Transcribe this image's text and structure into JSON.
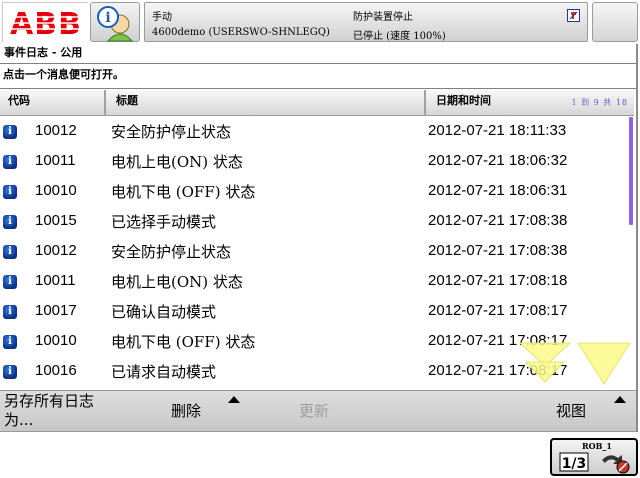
{
  "header": {
    "logo_text": "ABB",
    "mode": "手动",
    "system_name": "4600demo (USERSWO-SHNLEGQ)",
    "guard_status": "防护装置停止",
    "run_state": "已停止 (速度 100%)"
  },
  "window": {
    "title": "事件日志 - 公用",
    "hint": "点击一个消息便可打开。"
  },
  "table": {
    "columns": {
      "code": "代码",
      "title": "标题",
      "datetime": "日期和时间"
    },
    "record_count": "1 到 9 共 18",
    "rows": [
      {
        "code": "10012",
        "title": "安全防护停止状态",
        "datetime": "2012-07-21  18:11:33"
      },
      {
        "code": "10011",
        "title": "电机上电(ON) 状态",
        "datetime": "2012-07-21  18:06:32"
      },
      {
        "code": "10010",
        "title": "电机下电 (OFF) 状态",
        "datetime": "2012-07-21  18:06:31"
      },
      {
        "code": "10015",
        "title": "已选择手动模式",
        "datetime": "2012-07-21  17:08:38"
      },
      {
        "code": "10012",
        "title": "安全防护停止状态",
        "datetime": "2012-07-21  17:08:38"
      },
      {
        "code": "10011",
        "title": "电机上电(ON) 状态",
        "datetime": "2012-07-21  17:08:18"
      },
      {
        "code": "10017",
        "title": "已确认自动模式",
        "datetime": "2012-07-21  17:08:17"
      },
      {
        "code": "10010",
        "title": "电机下电 (OFF) 状态",
        "datetime": "2012-07-21  17:08:17"
      },
      {
        "code": "10016",
        "title": "已请求自动模式",
        "datetime": "2012-07-21  17:08:17"
      }
    ]
  },
  "commands": {
    "save_all": "另存所有日志为...",
    "delete": "删除",
    "refresh": "更新",
    "view": "视图"
  },
  "taskbar": {
    "robot": "ROB_1",
    "fraction": "1/3"
  },
  "colors": {
    "abb_red": "#e2000f",
    "info_icon": "#0b2f86",
    "scroll_thumb": "#8f64d6",
    "scroll_arrow": "#fafa8a",
    "count_text": "#7b4dc8"
  },
  "icons": {
    "info_button": "info-person-icon",
    "status_lamp": "guard-status-icon",
    "row_icon": "info-icon",
    "quickset": "jog-quickset-icon"
  }
}
